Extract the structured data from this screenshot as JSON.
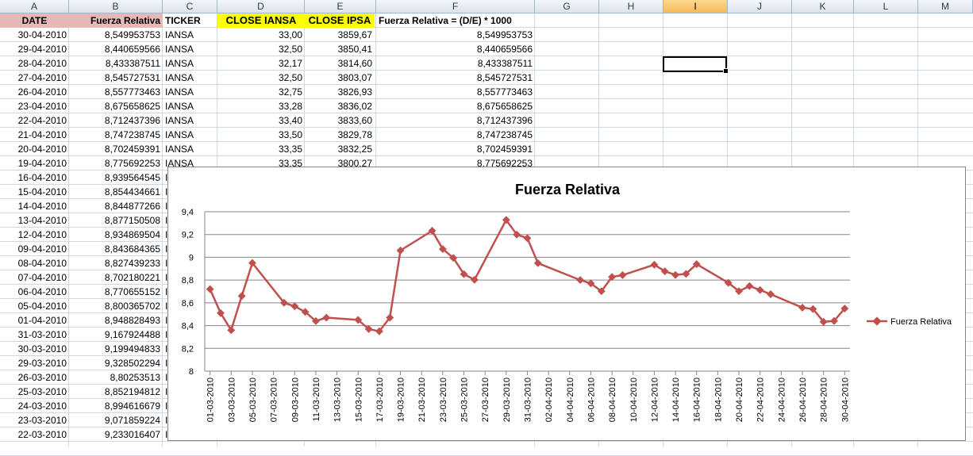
{
  "columns": [
    "A",
    "B",
    "C",
    "D",
    "E",
    "F",
    "G",
    "H",
    "I",
    "J",
    "K",
    "L",
    "M"
  ],
  "selected_column": "I",
  "headers": {
    "date": "DATE",
    "fuerza": "Fuerza Relativa",
    "ticker": "TICKER",
    "close_iansa": "CLOSE IANSA",
    "close_ipsa": "CLOSE IPSA",
    "formula": "Fuerza Relativa = (D/E) * 1000"
  },
  "rows": [
    {
      "date": "30-04-2010",
      "fr": "8,549953753",
      "ticker": "IANSA",
      "iansa": "33,00",
      "ipsa": "3859,67",
      "calc": "8,549953753"
    },
    {
      "date": "29-04-2010",
      "fr": "8,440659566",
      "ticker": "IANSA",
      "iansa": "32,50",
      "ipsa": "3850,41",
      "calc": "8,440659566"
    },
    {
      "date": "28-04-2010",
      "fr": "8,433387511",
      "ticker": "IANSA",
      "iansa": "32,17",
      "ipsa": "3814,60",
      "calc": "8,433387511"
    },
    {
      "date": "27-04-2010",
      "fr": "8,545727531",
      "ticker": "IANSA",
      "iansa": "32,50",
      "ipsa": "3803,07",
      "calc": "8,545727531"
    },
    {
      "date": "26-04-2010",
      "fr": "8,557773463",
      "ticker": "IANSA",
      "iansa": "32,75",
      "ipsa": "3826,93",
      "calc": "8,557773463"
    },
    {
      "date": "23-04-2010",
      "fr": "8,675658625",
      "ticker": "IANSA",
      "iansa": "33,28",
      "ipsa": "3836,02",
      "calc": "8,675658625"
    },
    {
      "date": "22-04-2010",
      "fr": "8,712437396",
      "ticker": "IANSA",
      "iansa": "33,40",
      "ipsa": "3833,60",
      "calc": "8,712437396"
    },
    {
      "date": "21-04-2010",
      "fr": "8,747238745",
      "ticker": "IANSA",
      "iansa": "33,50",
      "ipsa": "3829,78",
      "calc": "8,747238745"
    },
    {
      "date": "20-04-2010",
      "fr": "8,702459391",
      "ticker": "IANSA",
      "iansa": "33,35",
      "ipsa": "3832,25",
      "calc": "8,702459391"
    },
    {
      "date": "19-04-2010",
      "fr": "8,775692253",
      "ticker": "IANSA",
      "iansa": "33,35",
      "ipsa": "3800,27",
      "calc": "8,775692253"
    },
    {
      "date": "16-04-2010",
      "fr": "8,939564545",
      "ticker": "IA"
    },
    {
      "date": "15-04-2010",
      "fr": "8,854434661",
      "ticker": "IA"
    },
    {
      "date": "14-04-2010",
      "fr": "8,844877266",
      "ticker": "IA"
    },
    {
      "date": "13-04-2010",
      "fr": "8,877150508",
      "ticker": "IA"
    },
    {
      "date": "12-04-2010",
      "fr": "8,934869504",
      "ticker": "IA"
    },
    {
      "date": "09-04-2010",
      "fr": "8,843684365",
      "ticker": "IA"
    },
    {
      "date": "08-04-2010",
      "fr": "8,827439233",
      "ticker": "IA"
    },
    {
      "date": "07-04-2010",
      "fr": "8,702180221",
      "ticker": "IA"
    },
    {
      "date": "06-04-2010",
      "fr": "8,770655152",
      "ticker": "IA"
    },
    {
      "date": "05-04-2010",
      "fr": "8,800365702",
      "ticker": "IA"
    },
    {
      "date": "01-04-2010",
      "fr": "8,948828493",
      "ticker": "IA"
    },
    {
      "date": "31-03-2010",
      "fr": "9,167924488",
      "ticker": "IA"
    },
    {
      "date": "30-03-2010",
      "fr": "9,199494833",
      "ticker": "IA"
    },
    {
      "date": "29-03-2010",
      "fr": "9,328502294",
      "ticker": "IA"
    },
    {
      "date": "26-03-2010",
      "fr": "8,80253513",
      "ticker": "IA"
    },
    {
      "date": "25-03-2010",
      "fr": "8,852194812",
      "ticker": "IA"
    },
    {
      "date": "24-03-2010",
      "fr": "8,994616679",
      "ticker": "IA"
    },
    {
      "date": "23-03-2010",
      "fr": "9,071859224",
      "ticker": "IA"
    },
    {
      "date": "22-03-2010",
      "fr": "9,233016407",
      "ticker": "IA"
    }
  ],
  "chart_data": {
    "type": "line",
    "title": "Fuerza Relativa",
    "legend": "right",
    "series_color": "#c0504d",
    "ylim": [
      8,
      9.4
    ],
    "yticks": [
      "8",
      "8,2",
      "8,4",
      "8,6",
      "8,8",
      "9",
      "9,2",
      "9,4"
    ],
    "xlim": [
      "01-03-2010",
      "30-04-2010"
    ],
    "xtick_labels": [
      "01-03-2010",
      "03-03-2010",
      "05-03-2010",
      "07-03-2010",
      "09-03-2010",
      "11-03-2010",
      "13-03-2010",
      "15-03-2010",
      "17-03-2010",
      "19-03-2010",
      "21-03-2010",
      "23-03-2010",
      "25-03-2010",
      "27-03-2010",
      "29-03-2010",
      "31-03-2010",
      "02-04-2010",
      "04-04-2010",
      "06-04-2010",
      "08-04-2010",
      "10-04-2010",
      "12-04-2010",
      "14-04-2010",
      "16-04-2010",
      "18-04-2010",
      "20-04-2010",
      "22-04-2010",
      "24-04-2010",
      "26-04-2010",
      "28-04-2010",
      "30-04-2010"
    ],
    "grid": true,
    "series": [
      {
        "name": "Fuerza Relativa",
        "x": [
          "01-03-2010",
          "02-03-2010",
          "03-03-2010",
          "04-03-2010",
          "05-03-2010",
          "08-03-2010",
          "09-03-2010",
          "10-03-2010",
          "11-03-2010",
          "12-03-2010",
          "15-03-2010",
          "16-03-2010",
          "17-03-2010",
          "18-03-2010",
          "19-03-2010",
          "22-03-2010",
          "23-03-2010",
          "24-03-2010",
          "25-03-2010",
          "26-03-2010",
          "29-03-2010",
          "30-03-2010",
          "31-03-2010",
          "01-04-2010",
          "05-04-2010",
          "06-04-2010",
          "07-04-2010",
          "08-04-2010",
          "09-04-2010",
          "12-04-2010",
          "13-04-2010",
          "14-04-2010",
          "15-04-2010",
          "16-04-2010",
          "19-04-2010",
          "20-04-2010",
          "21-04-2010",
          "22-04-2010",
          "23-04-2010",
          "26-04-2010",
          "27-04-2010",
          "28-04-2010",
          "29-04-2010",
          "30-04-2010"
        ],
        "values": [
          8.72,
          8.51,
          8.36,
          8.66,
          8.95,
          8.6,
          8.57,
          8.52,
          8.44,
          8.47,
          8.45,
          8.37,
          8.35,
          8.47,
          9.06,
          9.233016407,
          9.071859224,
          8.994616679,
          8.852194812,
          8.80253513,
          9.328502294,
          9.199494833,
          9.167924488,
          8.948828493,
          8.800365702,
          8.770655152,
          8.702180221,
          8.827439233,
          8.843684365,
          8.934869504,
          8.877150508,
          8.844877266,
          8.854434661,
          8.939564545,
          8.775692253,
          8.702459391,
          8.747238745,
          8.712437396,
          8.675658625,
          8.557773463,
          8.545727531,
          8.433387511,
          8.440659566,
          8.549953753
        ]
      }
    ]
  }
}
